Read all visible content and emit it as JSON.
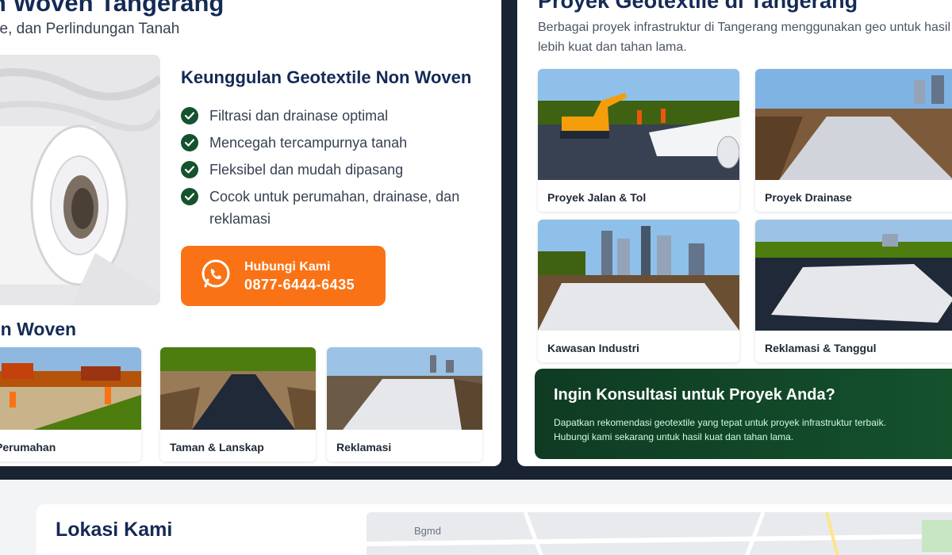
{
  "left_panel": {
    "hero_title": "on Woven Tangerang",
    "hero_subtitle": "se, dan Perlindungan Tanah",
    "features_title": "Keunggulan Geotextile Non Woven",
    "features": [
      "Filtrasi dan drainase optimal",
      "Mencegah tercampurnya tanah",
      "Fleksibel dan mudah dipasang",
      "Cocok untuk perumahan, drainase, dan reklamasi"
    ],
    "cta": {
      "line1": "Hubungi Kami",
      "line2": "0877-6444-6435"
    },
    "applications_title": "Non Woven",
    "applications": [
      {
        "label": "Perumahan"
      },
      {
        "label": "Taman & Lanskap"
      },
      {
        "label": "Reklamasi"
      }
    ]
  },
  "right_panel": {
    "title": "Proyek Geotextile di Tangerang",
    "subtitle": "Berbagai proyek infrastruktur di Tangerang menggunakan geo untuk hasil yang lebih kuat dan tahan lama.",
    "projects": [
      {
        "label": "Proyek Jalan & Tol"
      },
      {
        "label": "Proyek Drainase"
      },
      {
        "label": "Kawasan Industri"
      },
      {
        "label": "Reklamasi & Tanggul"
      }
    ],
    "consult": {
      "title": "Ingin Konsultasi untuk Proyek Anda?",
      "text": "Dapatkan rekomendasi geotextile yang tepat untuk proyek infrastruktur terbaik. Hubungi kami sekarang untuk hasil kuat dan tahan lama."
    }
  },
  "location": {
    "title": "Lokasi Kami",
    "map_label": "Bgmd"
  },
  "colors": {
    "navy": "#142a56",
    "accent_orange": "#f97316",
    "accent_green": "#14532d"
  },
  "icons": {
    "check": "check-circle-icon",
    "whatsapp": "whatsapp-icon"
  }
}
